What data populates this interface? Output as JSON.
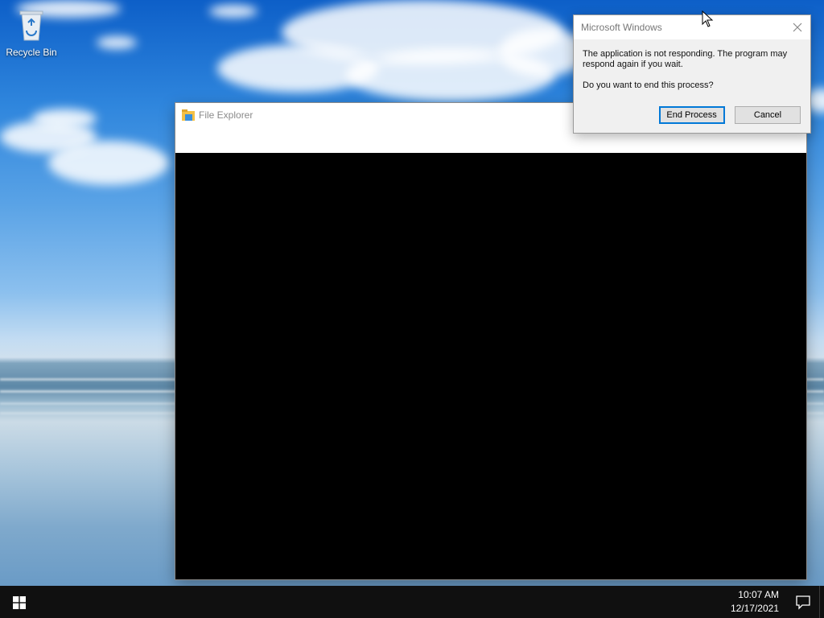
{
  "desktop": {
    "icons": [
      {
        "label": "Recycle Bin"
      }
    ]
  },
  "explorer": {
    "title": "File Explorer",
    "icon": "folder-icon"
  },
  "dialog": {
    "title": "Microsoft Windows",
    "message": "The application is not responding. The program may respond again if you wait.",
    "question": "Do you want to end this process?",
    "buttons": {
      "end_process": "End Process",
      "cancel": "Cancel"
    },
    "close_icon": "close-icon"
  },
  "taskbar": {
    "time": "10:07 AM",
    "date": "12/17/2021",
    "start_icon": "windows-logo-icon",
    "notification_icon": "action-center-icon"
  },
  "colors": {
    "accent": "#0078d7",
    "taskbar": "#101010",
    "dialog_bg": "#f0f0f0"
  }
}
